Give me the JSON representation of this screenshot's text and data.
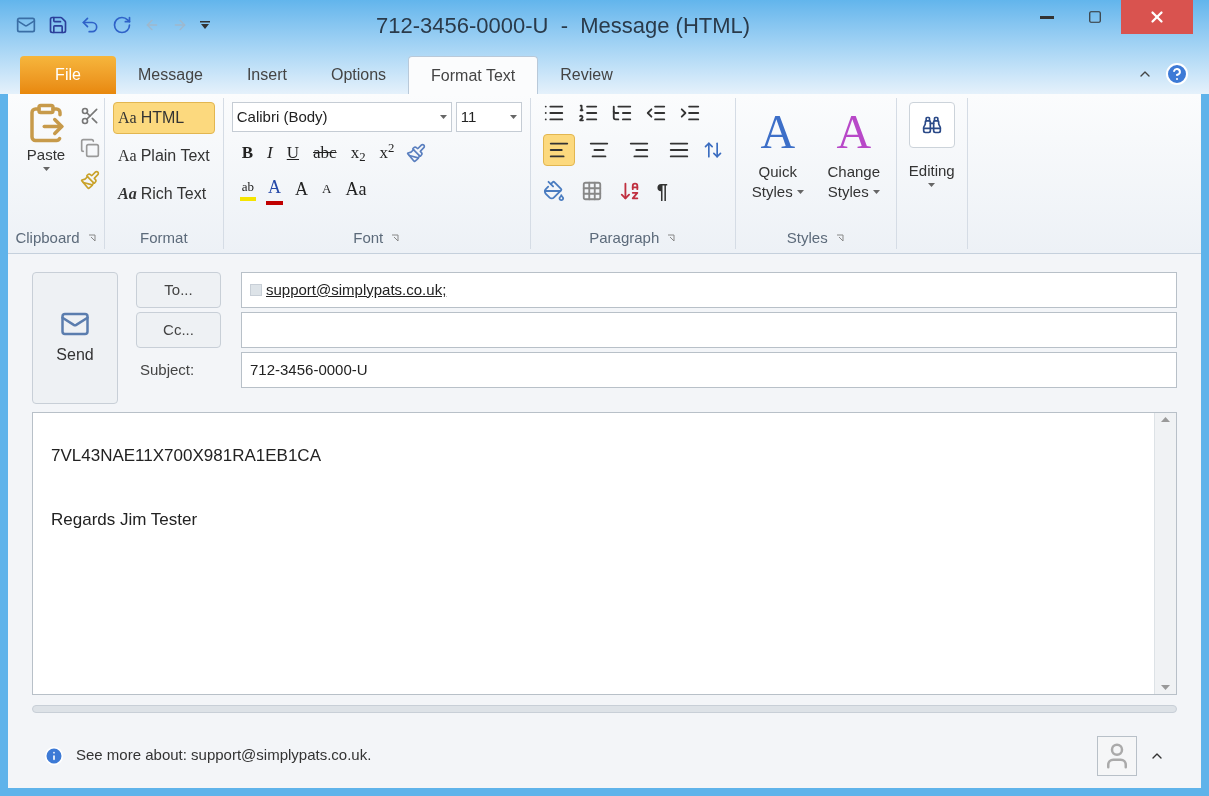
{
  "window": {
    "title": "712-3456-0000-U  -  Message (HTML)"
  },
  "tabs": [
    {
      "label": "File",
      "kind": "file",
      "selected": false
    },
    {
      "label": "Message",
      "kind": "tab",
      "selected": false
    },
    {
      "label": "Insert",
      "kind": "tab",
      "selected": false
    },
    {
      "label": "Options",
      "kind": "tab",
      "selected": false
    },
    {
      "label": "Format Text",
      "kind": "tab",
      "selected": true
    },
    {
      "label": "Review",
      "kind": "tab",
      "selected": false
    }
  ],
  "ribbon": {
    "clipboard": {
      "label": "Clipboard",
      "paste": "Paste"
    },
    "format": {
      "label": "Format",
      "options": [
        {
          "prefix": "Aa",
          "label": "HTML",
          "selected": true
        },
        {
          "prefix": "Aa",
          "label": "Plain Text",
          "selected": false
        },
        {
          "prefix": "Aa",
          "label": "Rich Text",
          "selected": false
        }
      ]
    },
    "font": {
      "label": "Font",
      "face": "Calibri (Body)",
      "size": "11",
      "row1": [
        "B",
        "I",
        "U",
        "abc",
        "x$_{2}$",
        "x$^{2}$"
      ],
      "row2": [
        "ab",
        "A",
        "A",
        "A",
        "Aa"
      ]
    },
    "paragraph": {
      "label": "Paragraph",
      "alignments": [
        {
          "kind": "left",
          "selected": true
        },
        {
          "kind": "center",
          "selected": false
        },
        {
          "kind": "right",
          "selected": false
        },
        {
          "kind": "justify",
          "selected": false
        }
      ],
      "pilcrow": "¶"
    },
    "styles": {
      "label": "Styles",
      "quick": {
        "glyph": "A",
        "lines": [
          "Quick",
          "Styles"
        ]
      },
      "change": {
        "glyph": "A",
        "lines": [
          "Change",
          "Styles"
        ]
      }
    },
    "editing": {
      "label": "Editing"
    }
  },
  "header": {
    "send": "Send",
    "to_button": "To...",
    "to_value": "support@simplypats.co.uk;",
    "cc_button": "Cc...",
    "subject_label": "Subject:",
    "subject_value": "712-3456-0000-U"
  },
  "body": [
    "7VL43NAE11X700X981RA1EB1CA",
    "Regards Jim Tester"
  ],
  "status_bar": {
    "text": "See more about: support@simplypats.co.uk."
  }
}
